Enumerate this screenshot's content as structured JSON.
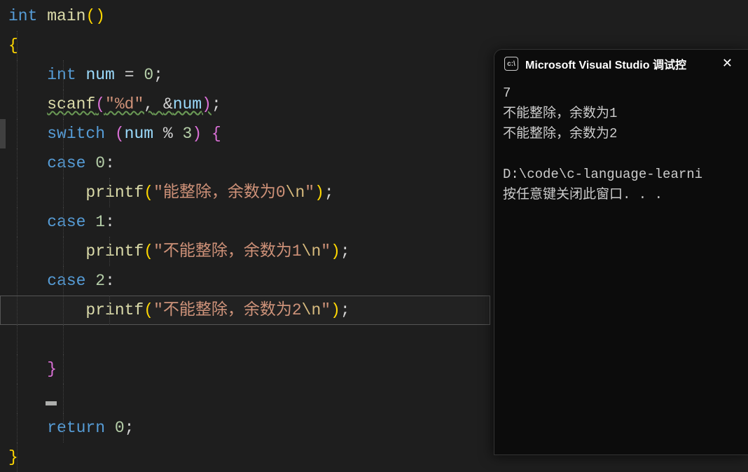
{
  "code": {
    "fn_sig_type": "int",
    "fn_name": "main",
    "decl_type": "int",
    "decl_name": "num",
    "decl_value": "0",
    "scanf_name": "scanf",
    "scanf_fmt": "\"%d\"",
    "scanf_arg": "&num",
    "switch_kw": "switch",
    "switch_expr_name": "num",
    "switch_expr_op": "%",
    "switch_expr_rhs": "3",
    "case_kw": "case",
    "case0": "0",
    "case1": "1",
    "case2": "2",
    "printf_name": "printf",
    "printf0_str": "\"能整除，余数为0",
    "printf1_str": "\"不能整除，余数为1",
    "printf2_str": "\"不能整除，余数为2",
    "esc_n": "\\n",
    "quote_close": "\"",
    "return_kw": "return",
    "return_val": "0"
  },
  "console": {
    "title": "Microsoft Visual Studio 调试控",
    "lines": "7\n不能整除，余数为1\n不能整除，余数为2\n\nD:\\code\\c-language-learni\n按任意键关闭此窗口. . ."
  }
}
